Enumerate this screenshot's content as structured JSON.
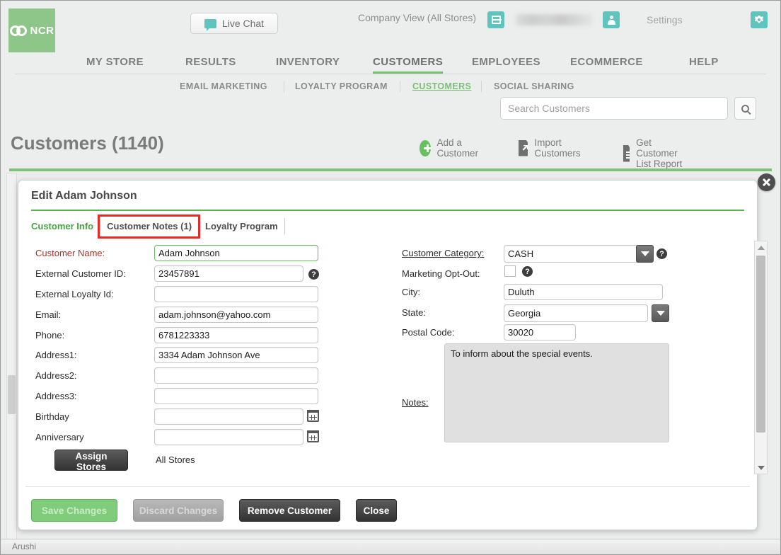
{
  "topbar": {
    "logo_text": "NCR",
    "live_chat": "Live Chat",
    "company_view": "Company View (All Stores)",
    "settings": "Settings",
    "icons": {
      "store": "store-icon",
      "user": "user-icon",
      "gear": "gear-icon",
      "chat": "chat-bubble-icon"
    }
  },
  "mainnav": {
    "items": [
      {
        "label": "MY STORE",
        "active": false
      },
      {
        "label": "RESULTS",
        "active": false
      },
      {
        "label": "INVENTORY",
        "active": false
      },
      {
        "label": "CUSTOMERS",
        "active": true
      },
      {
        "label": "EMPLOYEES",
        "active": false
      },
      {
        "label": "ECOMMERCE",
        "active": false
      },
      {
        "label": "HELP",
        "active": false
      }
    ]
  },
  "subnav": {
    "items": [
      {
        "label": "EMAIL MARKETING",
        "active": false
      },
      {
        "label": "LOYALTY PROGRAM",
        "active": false
      },
      {
        "label": "CUSTOMERS",
        "active": true
      },
      {
        "label": "SOCIAL SHARING",
        "active": false
      }
    ]
  },
  "search": {
    "placeholder": "Search Customers",
    "value": ""
  },
  "page": {
    "title": "Customers (1140)",
    "actions": [
      {
        "label": "Add a Customer"
      },
      {
        "label": "Import Customers"
      },
      {
        "label": "Get Customer List Report"
      }
    ]
  },
  "modal": {
    "title": "Edit Adam Johnson",
    "tabs": [
      {
        "label": "Customer Info",
        "active": true,
        "highlighted": false
      },
      {
        "label": "Customer Notes (1)",
        "active": false,
        "highlighted": true
      },
      {
        "label": "Loyalty Program",
        "active": false,
        "highlighted": false
      }
    ],
    "left_fields": [
      {
        "label": "Customer Name:",
        "value": "Adam Johnson"
      },
      {
        "label": "External Customer ID:",
        "value": "23457891"
      },
      {
        "label": "External Loyalty Id:",
        "value": ""
      },
      {
        "label": "Email:",
        "value": "adam.johnson@yahoo.com"
      },
      {
        "label": "Phone:",
        "value": "6781223333"
      },
      {
        "label": "Address1:",
        "value": "3334 Adam Johnson Ave"
      },
      {
        "label": "Address2:",
        "value": ""
      },
      {
        "label": "Address3:",
        "value": ""
      },
      {
        "label": "Birthday",
        "value": ""
      },
      {
        "label": "Anniversary",
        "value": ""
      }
    ],
    "assign_stores_button": "Assign Stores",
    "stores_value": "All Stores",
    "right_fields": {
      "customer_category_label": "Customer Category:",
      "customer_category_value": "CASH",
      "marketing_optout_label": "Marketing Opt-Out:",
      "marketing_optout_checked": false,
      "city_label": "City:",
      "city_value": "Duluth",
      "state_label": "State:",
      "state_value": "Georgia",
      "postal_label": "Postal Code:",
      "postal_value": "30020",
      "notes_label": "Notes:",
      "notes_value": "To inform about the special events."
    },
    "footer_buttons": [
      {
        "label": "Save Changes",
        "style": "green-disabled"
      },
      {
        "label": "Discard Changes",
        "style": "gray-disabled"
      },
      {
        "label": "Remove Customer",
        "style": "dark"
      },
      {
        "label": "Close",
        "style": "dark"
      }
    ]
  },
  "statusbar": {
    "text": "Arushi"
  },
  "colors": {
    "brand_green": "#8ec68a",
    "accent_teal": "#5ec4bd",
    "rule_green": "#7ec17b",
    "highlight_red": "#e62b25"
  }
}
